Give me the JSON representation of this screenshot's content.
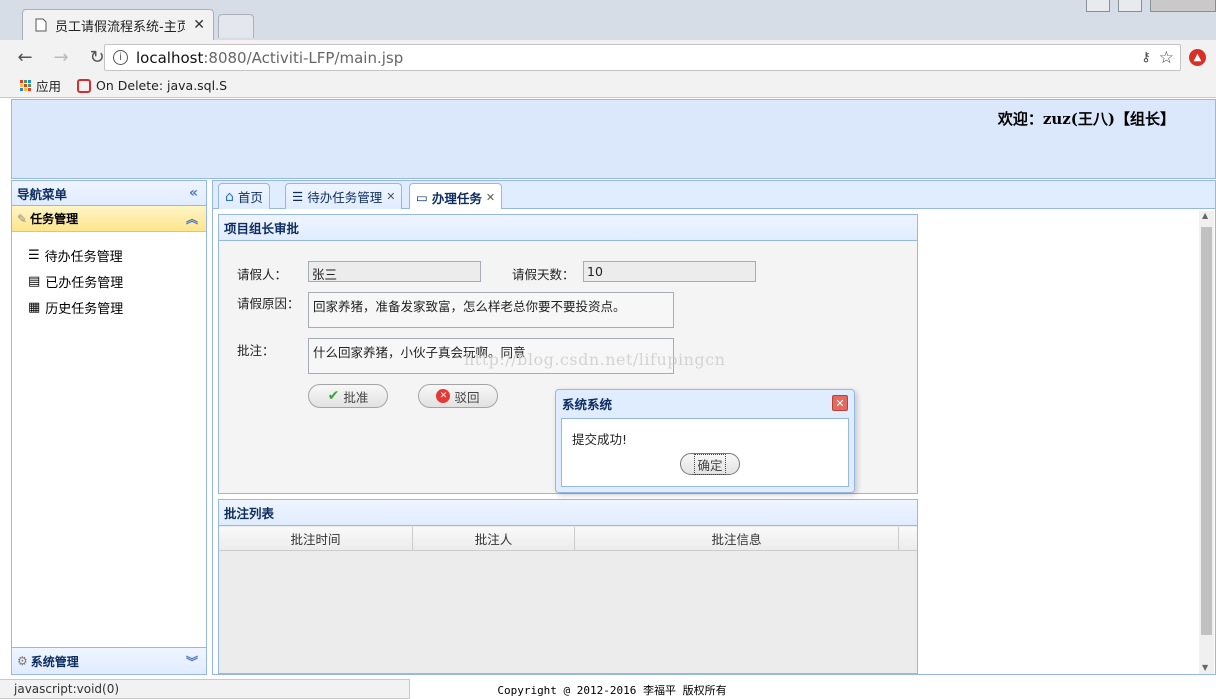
{
  "browser": {
    "tab_title": "员工请假流程系统-主页",
    "url_host": "localhost",
    "url_path": ":8080/Activiti-LFP/main.jsp",
    "bookmarks": [
      {
        "label": "应用",
        "icon": "apps-grid-icon"
      },
      {
        "label": "On Delete: java.sql.S",
        "icon": "oracle-icon"
      }
    ],
    "status_text": "javascript:void(0)"
  },
  "header": {
    "welcome": "欢迎：zuz(王八)【组长】"
  },
  "nav": {
    "title": "导航菜单",
    "section_task": "任务管理",
    "items": [
      {
        "label": "待办任务管理",
        "icon": "list-check-icon"
      },
      {
        "label": "已办任务管理",
        "icon": "document-icon"
      },
      {
        "label": "历史任务管理",
        "icon": "archive-icon"
      }
    ],
    "section_system": "系统管理"
  },
  "tabs": [
    {
      "label": "首页",
      "icon": "home-icon",
      "closable": false
    },
    {
      "label": "待办任务管理",
      "icon": "list-check-icon",
      "closable": true
    },
    {
      "label": "办理任务",
      "icon": "form-icon",
      "closable": true,
      "active": true
    }
  ],
  "form": {
    "panel_title": "项目组长审批",
    "applicant_label": "请假人：",
    "applicant_value": "张三",
    "days_label": "请假天数：",
    "days_value": "10",
    "reason_label": "请假原因：",
    "reason_value": "回家养猪，准备发家致富，怎么样老总你要不要投资点。",
    "comment_label": "批注：",
    "comment_value": "什么回家养猪，小伙子真会玩啊。同意",
    "approve_label": "批准",
    "reject_label": "驳回"
  },
  "comments": {
    "panel_title": "批注列表",
    "columns": [
      "批注时间",
      "批注人",
      "批注信息"
    ]
  },
  "watermark": "http://blog.csdn.net/lifupingcn",
  "dialog": {
    "title": "系统系统",
    "message": "提交成功!",
    "ok_label": "确定"
  },
  "footer": "Copyright @ 2012-2016 李福平 版权所有",
  "colors": {
    "accent_border": "#95b8e7",
    "header_bg": "#dbe8fb",
    "selected_bg": "#fde58c"
  }
}
